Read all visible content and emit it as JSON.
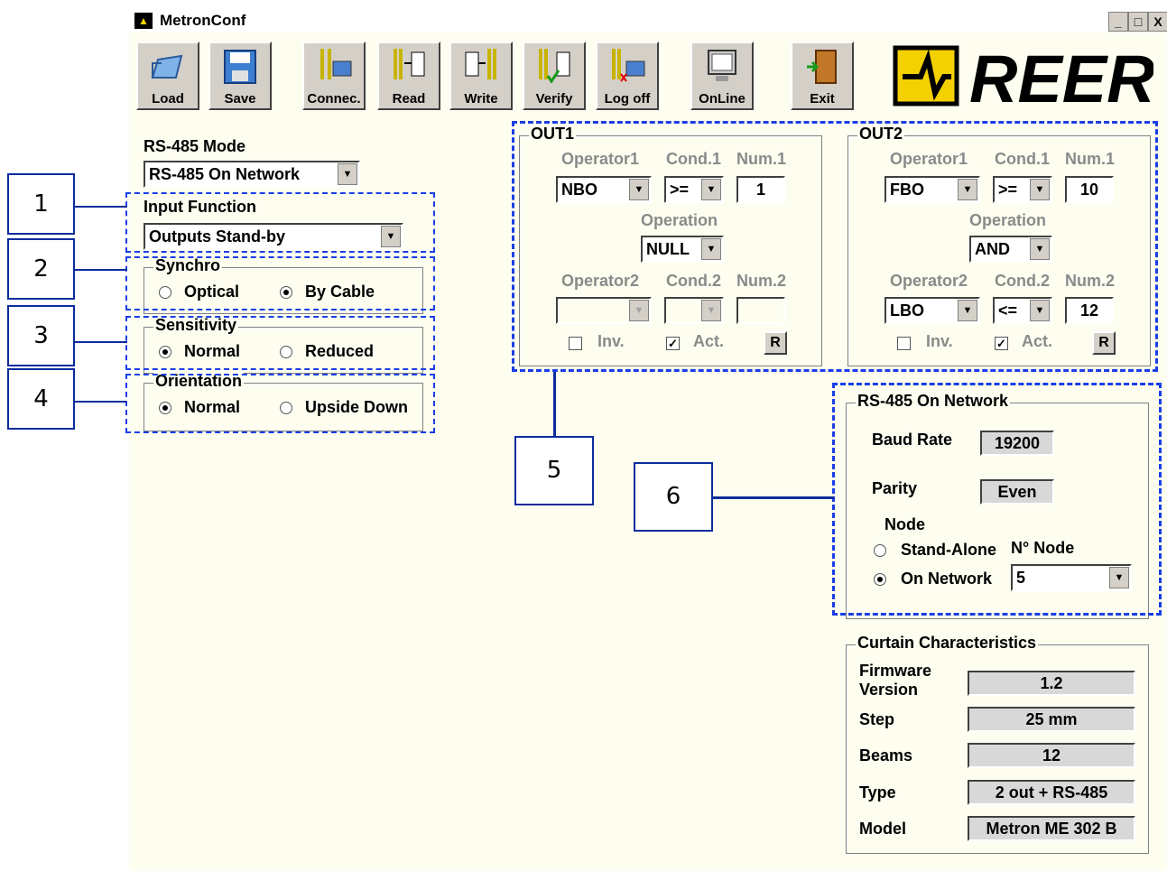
{
  "window": {
    "title": "MetronConf",
    "min": "_",
    "max": "□",
    "close": "X"
  },
  "toolbar": [
    {
      "id": "load",
      "label": "Load",
      "icon": "folder-open-icon"
    },
    {
      "id": "save",
      "label": "Save",
      "icon": "floppy-disk-icon"
    },
    {
      "id": "connect",
      "label": "Connec.",
      "icon": "connect-icon"
    },
    {
      "id": "read",
      "label": "Read",
      "icon": "read-icon"
    },
    {
      "id": "write",
      "label": "Write",
      "icon": "write-icon"
    },
    {
      "id": "verify",
      "label": "Verify",
      "icon": "verify-icon"
    },
    {
      "id": "logoff",
      "label": "Log off",
      "icon": "log-off-icon"
    },
    {
      "id": "online",
      "label": "OnLine",
      "icon": "monitor-icon"
    },
    {
      "id": "exit",
      "label": "Exit",
      "icon": "exit-door-icon"
    }
  ],
  "logo": {
    "text": "REER",
    "colors": {
      "accent": "#f3d000",
      "ink": "#000000"
    }
  },
  "left": {
    "rs485_label": "RS-485 Mode",
    "rs485_value": "RS-485 On Network",
    "input_function_label": "Input Function",
    "input_function_value": "Outputs Stand-by",
    "synchro": {
      "title": "Synchro",
      "opt1": "Optical",
      "opt2": "By Cable",
      "selected": "By Cable"
    },
    "sensitivity": {
      "title": "Sensitivity",
      "opt1": "Normal",
      "opt2": "Reduced",
      "selected": "Normal"
    },
    "orientation": {
      "title": "Orientation",
      "opt1": "Normal",
      "opt2": "Upside Down",
      "selected": "Normal"
    }
  },
  "out1": {
    "title": "OUT1",
    "operator1_label": "Operator1",
    "cond1_label": "Cond.1",
    "num1_label": "Num.1",
    "operator1": "NBO",
    "cond1": ">=",
    "num1": "1",
    "operation_label": "Operation",
    "operation": "NULL",
    "operator2_label": "Operator2",
    "cond2_label": "Cond.2",
    "num2_label": "Num.2",
    "operator2": "",
    "cond2": "",
    "num2": "",
    "inv_label": "Inv.",
    "inv": false,
    "act_label": "Act.",
    "act": true,
    "reset": "R"
  },
  "out2": {
    "title": "OUT2",
    "operator1_label": "Operator1",
    "cond1_label": "Cond.1",
    "num1_label": "Num.1",
    "operator1": "FBO",
    "cond1": ">=",
    "num1": "10",
    "operation_label": "Operation",
    "operation": "AND",
    "operator2_label": "Operator2",
    "cond2_label": "Cond.2",
    "num2_label": "Num.2",
    "operator2": "LBO",
    "cond2": "<=",
    "num2": "12",
    "inv_label": "Inv.",
    "inv": false,
    "act_label": "Act.",
    "act": true,
    "reset": "R"
  },
  "network": {
    "title": "RS-485 On Network",
    "baud_label": "Baud Rate",
    "baud": "19200",
    "parity_label": "Parity",
    "parity": "Even",
    "node_label": "Node",
    "standalone_label": "Stand-Alone",
    "nnode_label": "N° Node",
    "onnetwork_label": "On Network",
    "node_value": "5",
    "selected": "On Network"
  },
  "curtain": {
    "title": "Curtain Characteristics",
    "rows": [
      {
        "label": "Firmware Version",
        "value": "1.2"
      },
      {
        "label": "Step",
        "value": "25 mm"
      },
      {
        "label": "Beams",
        "value": "12"
      },
      {
        "label": "Type",
        "value": "2 out + RS-485"
      },
      {
        "label": "Model",
        "value": "Metron ME 302 B"
      }
    ]
  },
  "callouts": [
    "1",
    "2",
    "3",
    "4",
    "5",
    "6"
  ],
  "callout_color": "#1a3ee6"
}
